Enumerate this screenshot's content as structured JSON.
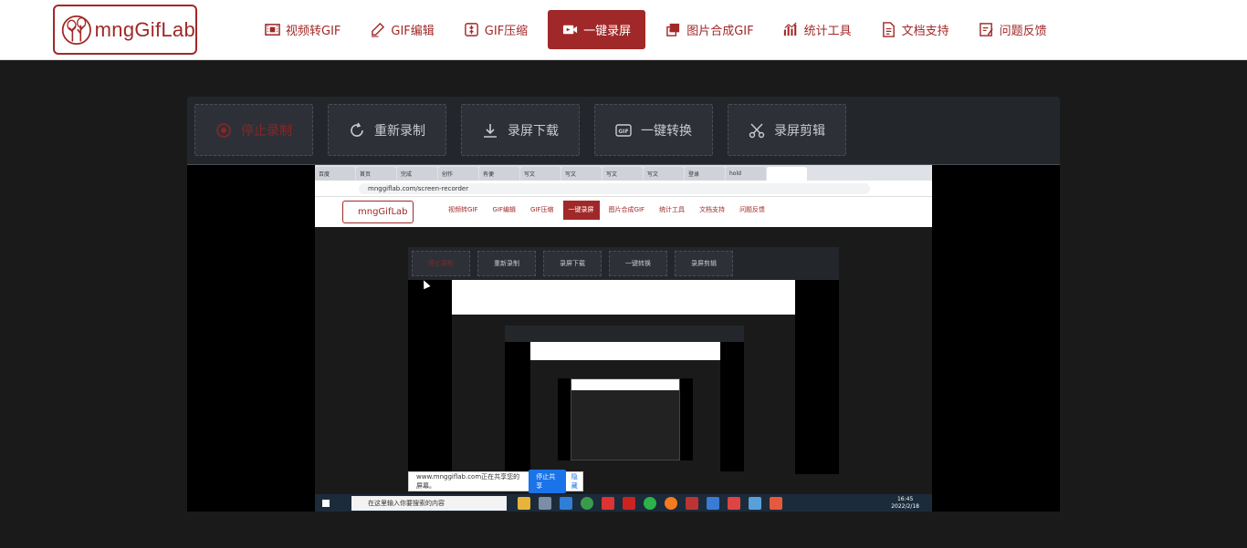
{
  "brand": {
    "logo_text": "mngGifLab",
    "accent": "#a12828"
  },
  "nav": {
    "items": [
      {
        "label": "视频转GIF",
        "icon": "film-icon"
      },
      {
        "label": "GIF编辑",
        "icon": "pen-icon"
      },
      {
        "label": "GIF压缩",
        "icon": "compress-icon"
      },
      {
        "label": "一键录屏",
        "icon": "video-camera-icon"
      },
      {
        "label": "图片合成GIF",
        "icon": "images-icon"
      },
      {
        "label": "统计工具",
        "icon": "bar-chart-icon"
      },
      {
        "label": "文档支持",
        "icon": "document-icon"
      },
      {
        "label": "问题反馈",
        "icon": "feedback-icon"
      }
    ],
    "active": "一键录屏"
  },
  "toolbar": {
    "stop": "停止录制",
    "restart": "重新录制",
    "download": "录屏下载",
    "convert": "一键转换",
    "edit": "录屏剪辑"
  },
  "preview": {
    "url": "mnggiflab.com/screen-recorder",
    "tabs": [
      "百度",
      "首页",
      "完成",
      "创作",
      "有便",
      "写文",
      "写文",
      "写文",
      "写文",
      "登录",
      "hold",
      ""
    ],
    "inner_logo": "mngGifLab",
    "inner_nav": [
      "视频转GIF",
      "GIF编辑",
      "GIF压缩",
      "一键录屏",
      "图片合成GIF",
      "统计工具",
      "文档支持",
      "问题反馈"
    ],
    "inner_tools": [
      "停止录制",
      "重新录制",
      "录屏下载",
      "一键转换",
      "录屏剪辑"
    ],
    "share_text": "www.mnggiflab.com正在共享您的屏幕。",
    "share_button": "停止共享",
    "hide_button": "隐藏",
    "taskbar_search": "在这里输入你要搜索的内容",
    "clock_time": "16:45",
    "clock_date": "2022/2/18"
  }
}
